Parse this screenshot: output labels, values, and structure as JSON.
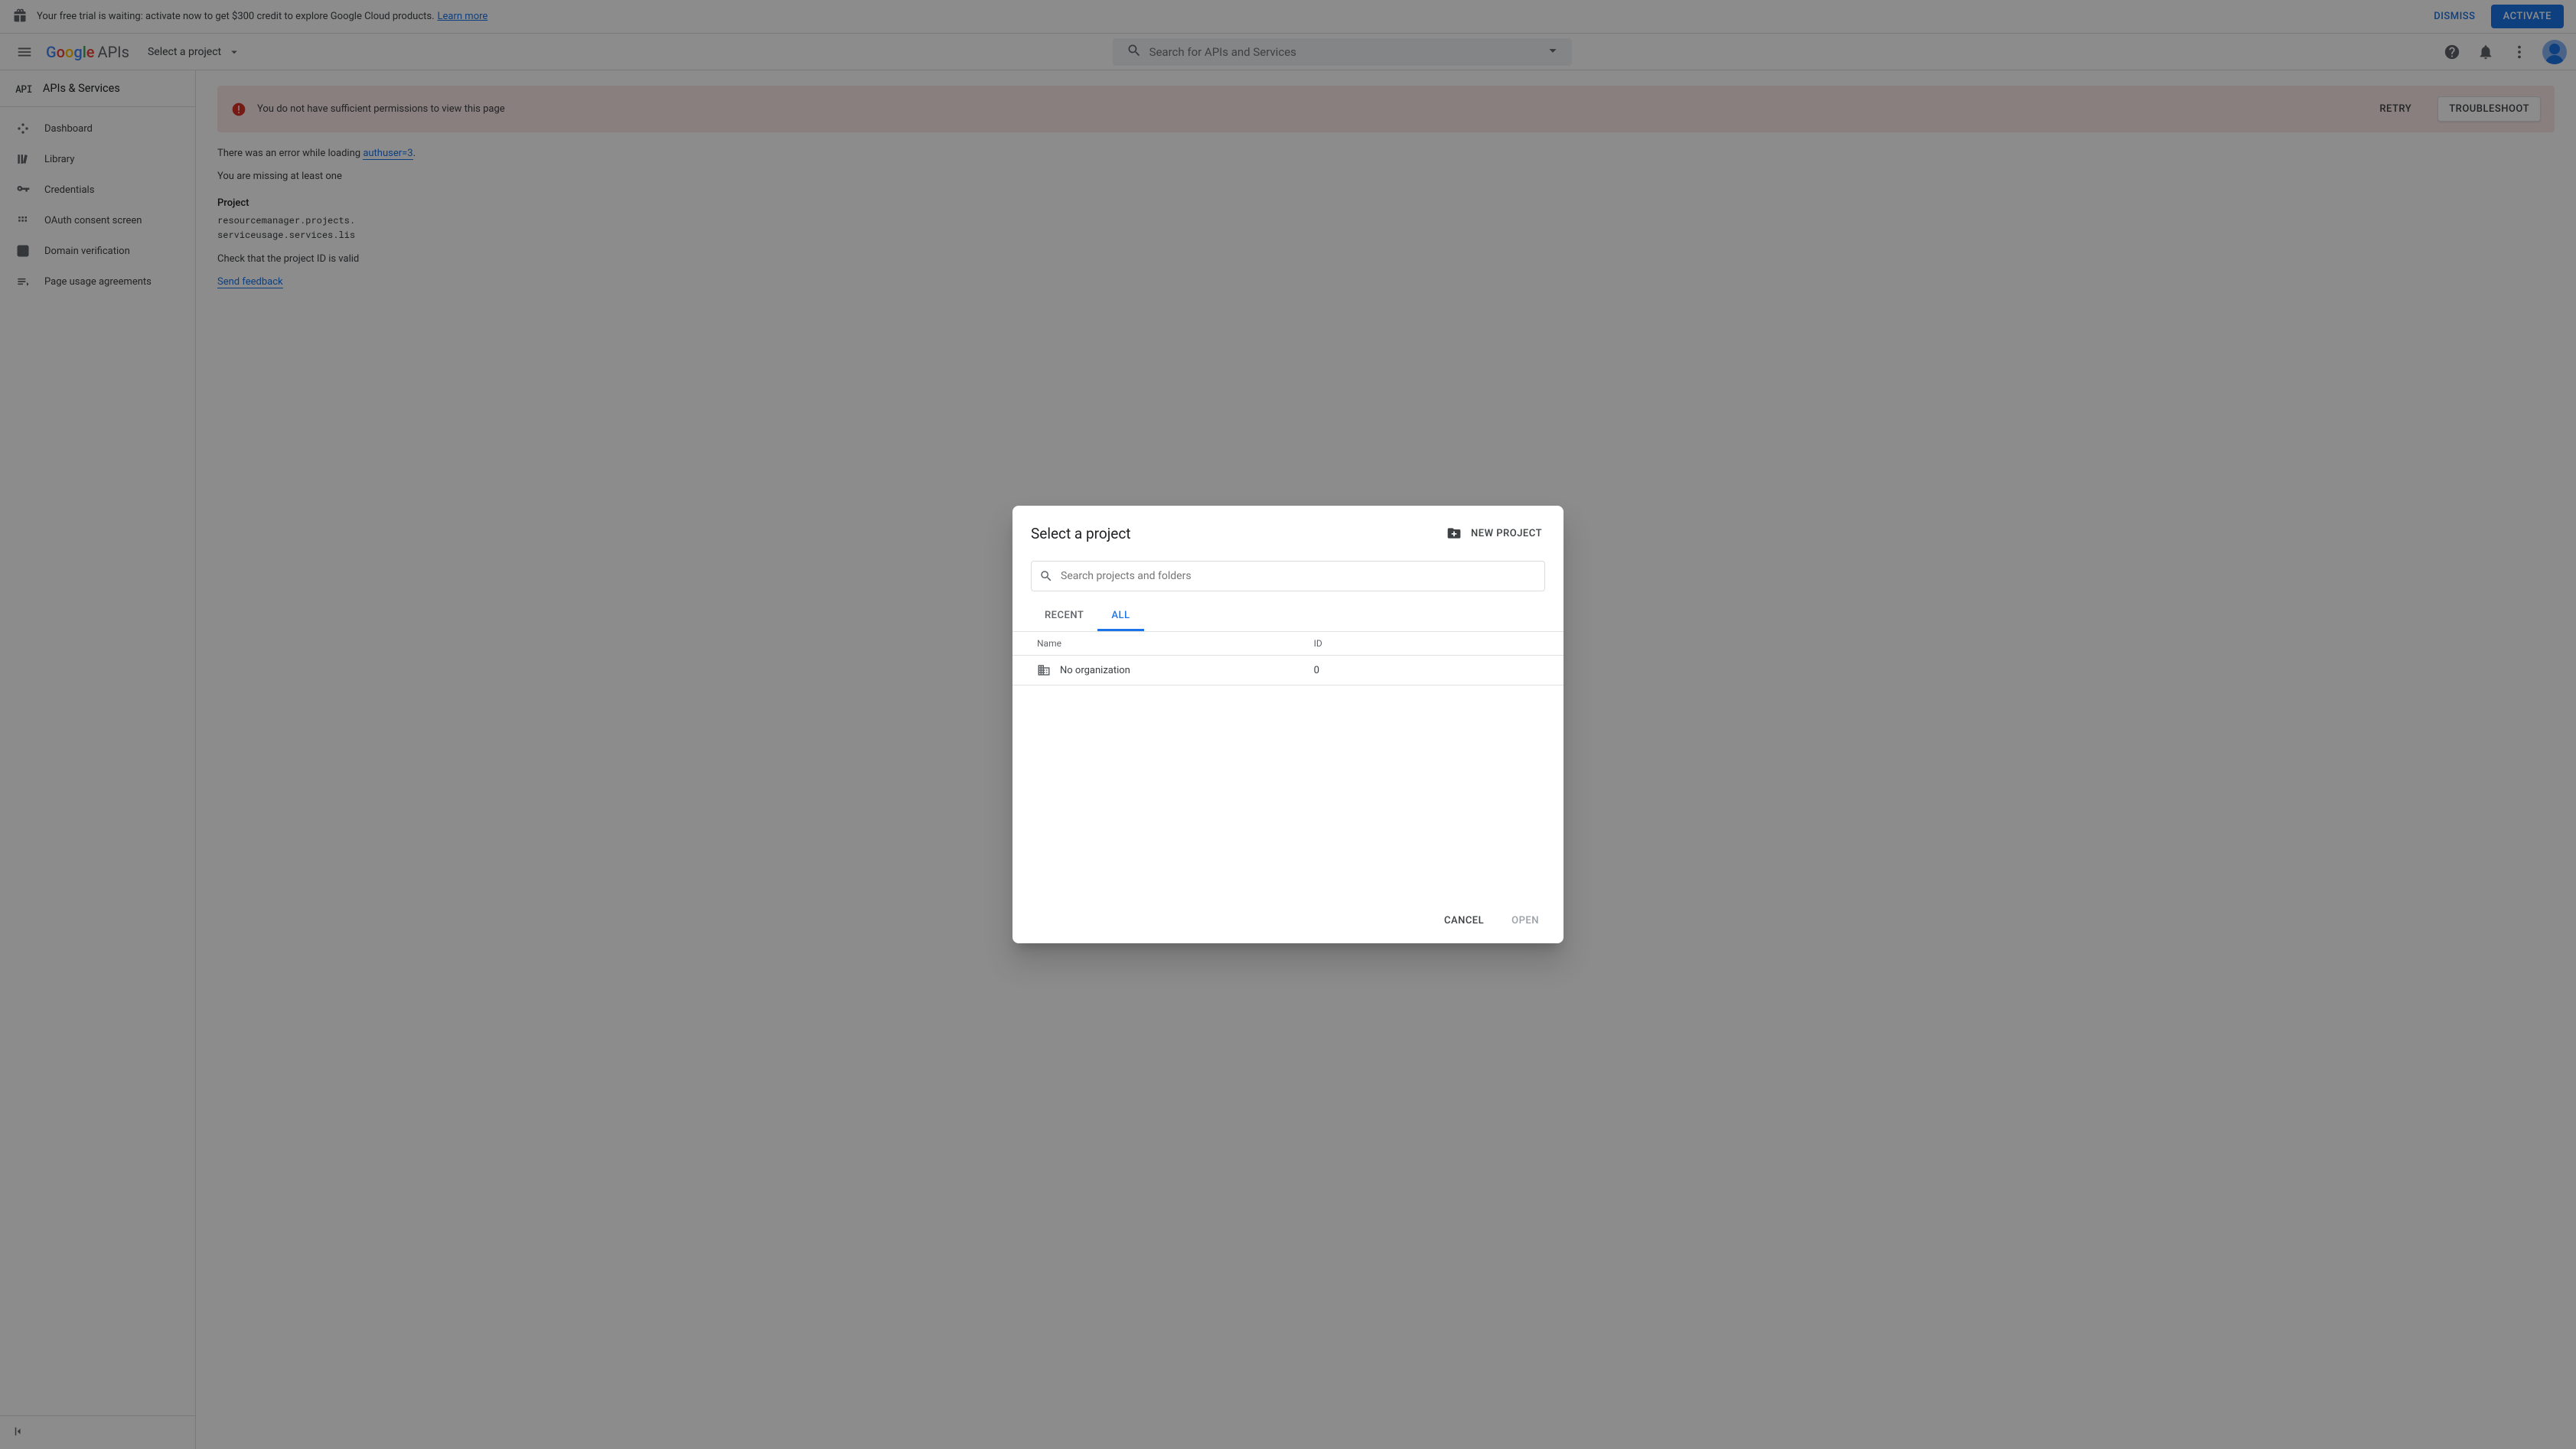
{
  "promo": {
    "text": "Your free trial is waiting: activate now to get $300 credit to explore Google Cloud products.",
    "learn_more": "Learn more",
    "dismiss": "DISMISS",
    "activate": "ACTIVATE"
  },
  "header": {
    "logo_suffix": "APIs",
    "project_picker_label": "Select a project",
    "search_placeholder": "Search for APIs and Services"
  },
  "sidebar": {
    "badge": "API",
    "title": "APIs & Services",
    "items": [
      {
        "label": "Dashboard"
      },
      {
        "label": "Library"
      },
      {
        "label": "Credentials"
      },
      {
        "label": "OAuth consent screen"
      },
      {
        "label": "Domain verification"
      },
      {
        "label": "Page usage agreements"
      }
    ]
  },
  "main": {
    "error_banner": "You do not have sufficient permissions to view this page",
    "retry": "RETRY",
    "troubleshoot": "TROUBLESHOOT",
    "error_line": "There was an error while loading",
    "error_link": "authuser=3",
    "missing_line": "You are missing at least one",
    "project_heading": "Project",
    "project_perm1": "resourcemanager.projects.",
    "project_perm2": "serviceusage.services.lis",
    "check_line": "Check that the project ID is valid",
    "send_feedback": "Send feedback"
  },
  "modal": {
    "title": "Select a project",
    "new_project": "NEW PROJECT",
    "search_placeholder": "Search projects and folders",
    "tab_recent": "RECENT",
    "tab_all": "ALL",
    "col_name": "Name",
    "col_id": "ID",
    "row_name": "No organization",
    "row_id": "0",
    "cancel": "CANCEL",
    "open": "OPEN"
  }
}
